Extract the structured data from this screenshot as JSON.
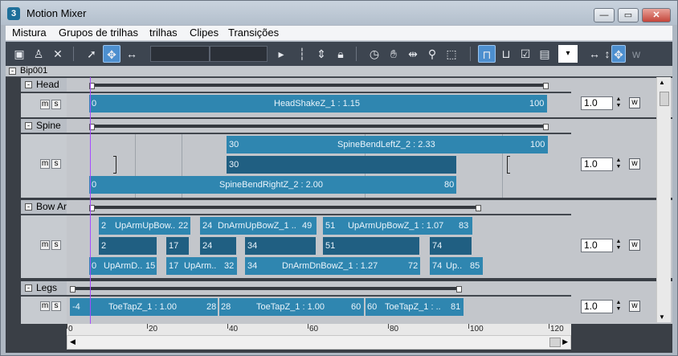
{
  "window": {
    "title": "Motion Mixer",
    "min": "—",
    "max": "▭",
    "close": "✕",
    "icon": "3ds-icon"
  },
  "menu": [
    "Mistura",
    "Grupos de trilhas",
    "trilhas",
    "Clipes",
    "Transições"
  ],
  "root": {
    "label": "Bip001",
    "toggle": "-"
  },
  "tracks": {
    "head": {
      "name": "Head",
      "m": "m",
      "s": "s",
      "weight": "1.0",
      "w": "w",
      "clip1": {
        "start": "0",
        "name": "HeadShakeZ_1 : 1.15",
        "end": "100"
      }
    },
    "spine": {
      "name": "Spine",
      "m": "m",
      "s": "s",
      "weight": "1.0",
      "w": "w",
      "clipA": {
        "start": "30",
        "name": "SpineBendLeftZ_2 : 2.33",
        "end": "100"
      },
      "clipB": {
        "start": "30"
      },
      "clipC": {
        "start": "0",
        "name": "SpineBendRightZ_2 : 2.00",
        "end": "80"
      }
    },
    "bowarm": {
      "name": "Bow Arm",
      "m": "m",
      "s": "s",
      "weight": "1.0",
      "w": "w",
      "r1": [
        {
          "a": "2",
          "n": "UpArmUpBow..",
          "b": "22"
        },
        {
          "a": "24",
          "n": "DnArmUpBowZ_1 ..",
          "b": "49"
        },
        {
          "a": "51",
          "n": "UpArmUpBowZ_1 : 1.07",
          "b": "83"
        }
      ],
      "r2": [
        "2",
        "17",
        "24",
        "34",
        "51",
        "74"
      ],
      "r3": [
        {
          "a": "0",
          "n": "UpArmD..",
          "b": "15"
        },
        {
          "a": "17",
          "n": "UpArm..",
          "b": "32"
        },
        {
          "a": "34",
          "n": "DnArmDnBowZ_1 : 1.27",
          "b": "72"
        },
        {
          "a": "74",
          "n": "Up..",
          "b": "85"
        }
      ]
    },
    "legs": {
      "name": "Legs",
      "m": "m",
      "s": "s",
      "weight": "1.0",
      "w": "w",
      "clips": [
        {
          "a": "-4",
          "n": "ToeTapZ_1 : 1.00",
          "b": "28"
        },
        {
          "a": "28",
          "n": "ToeTapZ_1 : 1.00",
          "b": "60"
        },
        {
          "a": "60",
          "n": "ToeTapZ_1 : ..",
          "b": "81"
        }
      ]
    }
  },
  "ruler": [
    "0",
    "20",
    "40",
    "60",
    "80",
    "100",
    "120"
  ]
}
